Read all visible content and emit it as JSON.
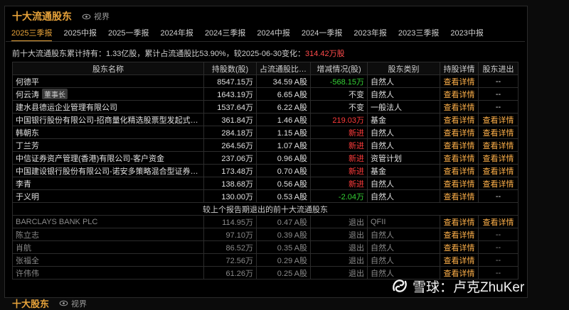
{
  "header": {
    "title": "十大流通股东",
    "view_label": "视界"
  },
  "tabs": [
    {
      "label": "2025三季报",
      "active": true
    },
    {
      "label": "2025中报"
    },
    {
      "label": "2025一季报"
    },
    {
      "label": "2024年报"
    },
    {
      "label": "2024三季报"
    },
    {
      "label": "2024中报"
    },
    {
      "label": "2024一季报"
    },
    {
      "label": "2023年报"
    },
    {
      "label": "2023三季报"
    },
    {
      "label": "2023中报"
    }
  ],
  "summary": {
    "text": "前十大流通股东累计持有：1.33亿股，累计占流通股比53.90%，较2025-06-30变化：",
    "change": "314.42万股"
  },
  "table": {
    "columns": [
      "股东名称",
      "持股数(股)",
      "占流通股比(%)",
      "增减情况(股)",
      "股东类别",
      "持股详情",
      "股东进出"
    ],
    "rows": [
      {
        "name": "何德平",
        "tag": "",
        "shares": "8547.15万",
        "ratio": "34.59 A股",
        "change": "-568.15万",
        "change_type": "green",
        "category": "自然人",
        "detail": "查看详情",
        "inout": "--"
      },
      {
        "name": "何云涛",
        "tag": "董事长",
        "shares": "1643.19万",
        "ratio": "6.65 A股",
        "change": "不变",
        "change_type": "plain",
        "category": "自然人",
        "detail": "查看详情",
        "inout": "--"
      },
      {
        "name": "建水县德运企业管理有限公司",
        "tag": "",
        "shares": "1537.64万",
        "ratio": "6.22 A股",
        "change": "不变",
        "change_type": "plain",
        "category": "一般法人",
        "detail": "查看详情",
        "inout": "--"
      },
      {
        "name": "中国银行股份有限公司-招商量化精选股票型发起式证券...",
        "tag": "",
        "shares": "361.84万",
        "ratio": "1.46 A股",
        "change": "219.03万",
        "change_type": "red",
        "category": "基金",
        "detail": "查看详情",
        "inout": "查看详情"
      },
      {
        "name": "韩朝东",
        "tag": "",
        "shares": "284.18万",
        "ratio": "1.15 A股",
        "change": "新进",
        "change_type": "red",
        "category": "自然人",
        "detail": "查看详情",
        "inout": "查看详情"
      },
      {
        "name": "丁兰芳",
        "tag": "",
        "shares": "264.56万",
        "ratio": "1.07 A股",
        "change": "新进",
        "change_type": "red",
        "category": "自然人",
        "detail": "查看详情",
        "inout": "查看详情"
      },
      {
        "name": "中信证券资产管理(香港)有限公司-客户资金",
        "tag": "",
        "shares": "237.06万",
        "ratio": "0.96 A股",
        "change": "新进",
        "change_type": "red",
        "category": "资管计划",
        "detail": "查看详情",
        "inout": "查看详情"
      },
      {
        "name": "中国建设银行股份有限公司-诺安多策略混合型证券投资...",
        "tag": "",
        "shares": "173.48万",
        "ratio": "0.70 A股",
        "change": "新进",
        "change_type": "red",
        "category": "基金",
        "detail": "查看详情",
        "inout": "查看详情"
      },
      {
        "name": "李青",
        "tag": "",
        "shares": "138.68万",
        "ratio": "0.56 A股",
        "change": "新进",
        "change_type": "red",
        "category": "自然人",
        "detail": "查看详情",
        "inout": "查看详情"
      },
      {
        "name": "于义明",
        "tag": "",
        "shares": "130.00万",
        "ratio": "0.53 A股",
        "change": "-2.04万",
        "change_type": "green",
        "category": "自然人",
        "detail": "查看详情",
        "inout": "--"
      }
    ],
    "separator": "较上个报告期退出的前十大流通股东",
    "exit_rows": [
      {
        "name": "BARCLAYS BANK PLC",
        "shares": "114.95万",
        "ratio": "0.47 A股",
        "change": "退出",
        "category": "QFII",
        "detail": "查看详情",
        "inout": "查看详情"
      },
      {
        "name": "陈立志",
        "shares": "97.10万",
        "ratio": "0.39 A股",
        "change": "退出",
        "category": "自然人",
        "detail": "查看详情",
        "inout": "--"
      },
      {
        "name": "肖航",
        "shares": "86.52万",
        "ratio": "0.35 A股",
        "change": "退出",
        "category": "自然人",
        "detail": "查看详情",
        "inout": "--"
      },
      {
        "name": "张福全",
        "shares": "72.56万",
        "ratio": "0.29 A股",
        "change": "退出",
        "category": "自然人",
        "detail": "查看详情",
        "inout": "--"
      },
      {
        "name": "许伟伟",
        "shares": "61.26万",
        "ratio": "0.25 A股",
        "change": "退出",
        "category": "自然人",
        "detail": "查看详情",
        "inout": "--"
      }
    ]
  },
  "bottom": {
    "title": "十大股东",
    "view_label": "视界"
  },
  "watermark": {
    "text": "雪球：卢克ZhuKer"
  },
  "colors": {
    "accent": "#e8a33a",
    "red": "#ff3b3b",
    "green": "#35d135",
    "link": "#ffb14a"
  }
}
